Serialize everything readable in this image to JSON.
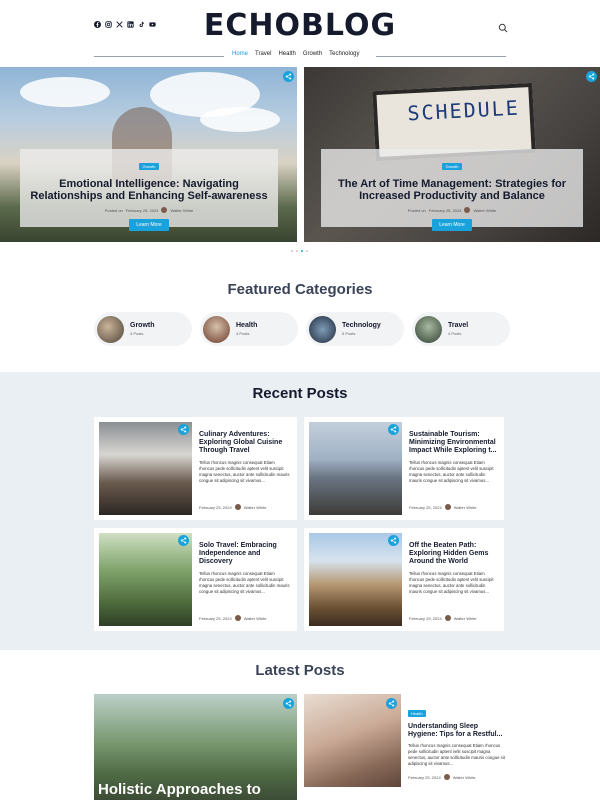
{
  "header": {
    "brand": "ECHOBLOG",
    "socials": [
      "facebook-icon",
      "instagram-icon",
      "x-icon",
      "linkedin-icon",
      "tiktok-icon",
      "youtube-icon"
    ],
    "nav": [
      "Home",
      "Travel",
      "Health",
      "Growth",
      "Technology"
    ],
    "active_nav": "Home"
  },
  "hero": [
    {
      "badge": "Growth",
      "title": "Emotional Intelligence: Navigating Relationships and Enhancing Self-awareness",
      "posted_label": "Posted on",
      "date": "February 25, 2024",
      "author": "Walter White",
      "button": "Learn More"
    },
    {
      "badge": "Growth",
      "title": "The Art of Time Management: Strategies for Increased Productivity and Balance",
      "posted_label": "Posted on",
      "date": "February 25, 2024",
      "author": "Walter White",
      "button": "Learn More",
      "image_text": "SCHEDULE"
    }
  ],
  "featured": {
    "title": "Featured Categories",
    "items": [
      {
        "name": "Growth",
        "count": "4 Posts"
      },
      {
        "name": "Health",
        "count": "4 Posts"
      },
      {
        "name": "Technology",
        "count": "5 Posts"
      },
      {
        "name": "Travel",
        "count": "4 Posts"
      }
    ]
  },
  "recent": {
    "title": "Recent Posts",
    "posts": [
      {
        "title": "Culinary Adventures: Exploring Global Cuisine Through Travel",
        "excerpt": "Tellus rhoncus magnis consequat Etiam rhoncus pede sollicitudin aptent velit suscipit magna senectus, auctor ante sollicitudin mauris congue sit adipiscing sit vivamus...",
        "date": "February 25, 2024",
        "author": "Walter White"
      },
      {
        "title": "Sustainable Tourism: Minimizing Environmental Impact While Exploring t...",
        "excerpt": "Tellus rhoncus magnis consequat Etiam rhoncus pede sollicitudin aptent velit suscipit magna senectus, auctor ante sollicitudin mauris congue sit adipiscing sit vivamus...",
        "date": "February 25, 2024",
        "author": "Walter White"
      },
      {
        "title": "Solo Travel: Embracing Independence and Discovery",
        "excerpt": "Tellus rhoncus magnis consequat Etiam rhoncus pede sollicitudin aptent velit suscipit magna senectus, auctor ante sollicitudin mauris congue sit adipiscing sit vivamus...",
        "date": "February 25, 2024",
        "author": "Walter White"
      },
      {
        "title": "Off the Beaten Path: Exploring Hidden Gems Around the World",
        "excerpt": "Tellus rhoncus magnis consequat Etiam rhoncus pede sollicitudin aptent velit suscipit magna senectus, auctor ante sollicitudin mauris congue sit adipiscing sit vivamus...",
        "date": "February 25, 2024",
        "author": "Walter White"
      }
    ]
  },
  "latest": {
    "title": "Latest Posts",
    "big_title": "Holistic Approaches to",
    "side": {
      "badge": "Health",
      "title": "Understanding Sleep Hygiene: Tips for a Restful...",
      "excerpt": "Tellus rhoncus magnis consequat Etiam rhoncus pede sollicitudin aptent velit suscipit magna senectus, auctor ante sollicitudin mauris congue sit adipiscing sit vivamus...",
      "date": "February 25, 2024",
      "author": "Walter White"
    }
  },
  "colors": {
    "accent": "#1aa2dc",
    "heading": "#151a2d",
    "section_bg": "#e9eff3"
  }
}
